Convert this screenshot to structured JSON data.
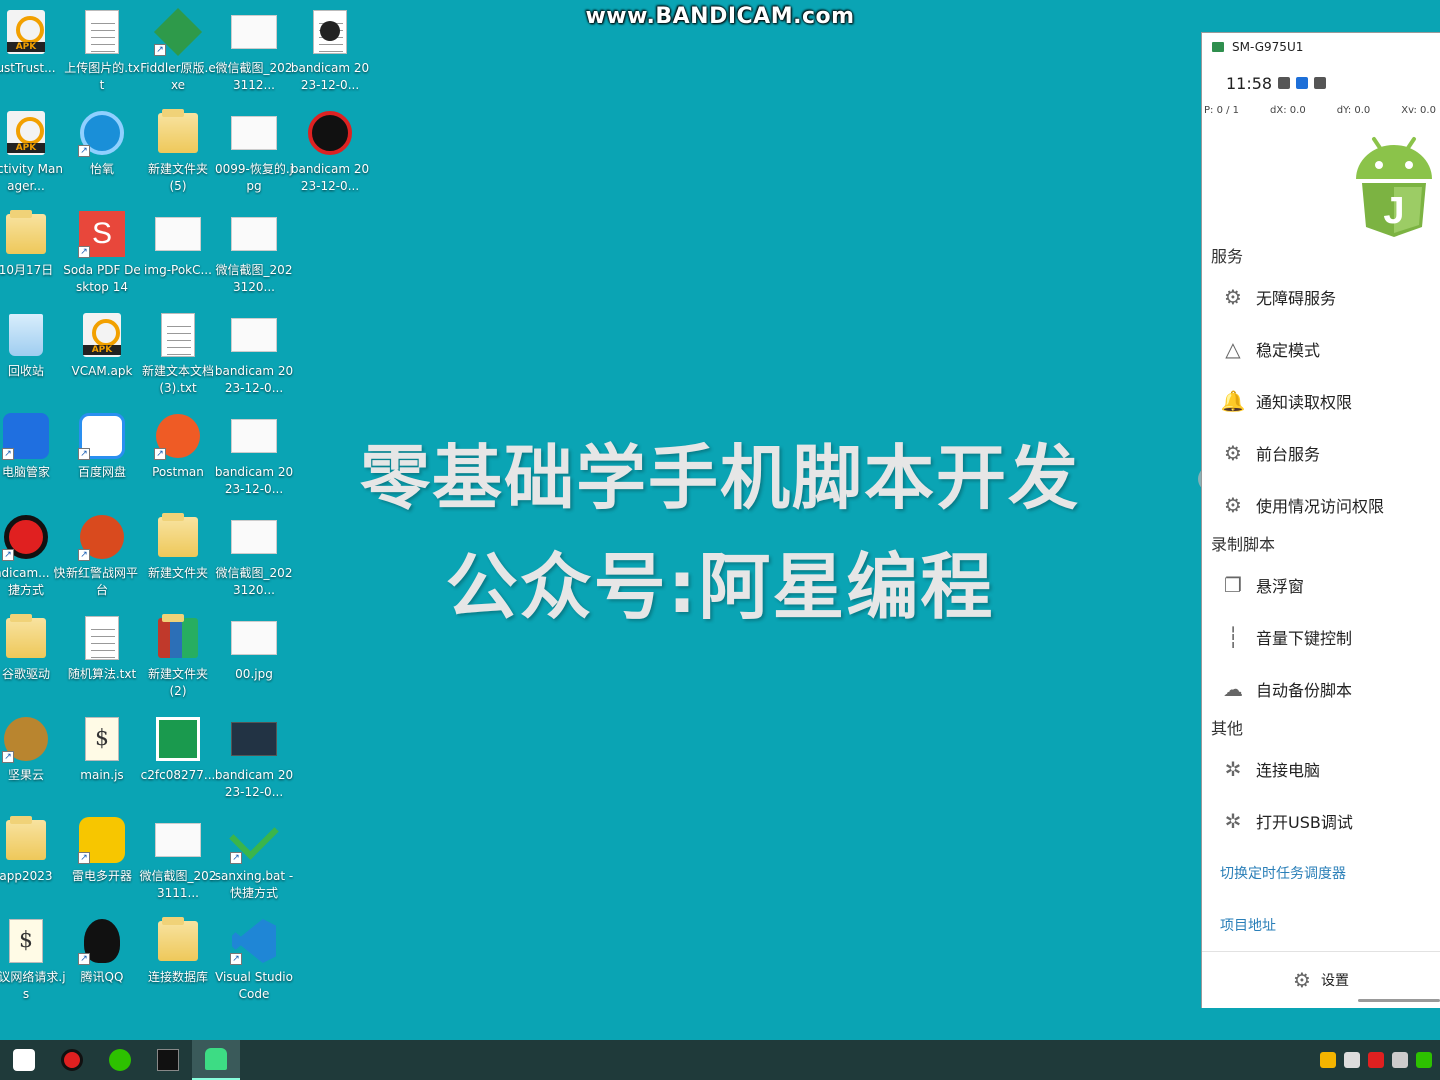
{
  "watermark": "www.BANDICAM.com",
  "overlay": {
    "line1": "零基础学手机脚本开发",
    "line2": "公众号:阿星编程"
  },
  "desktop_icons": [
    {
      "label": "ustTrust...",
      "icon": "apk-icon",
      "col": 0,
      "row": 0
    },
    {
      "label": "上传图片的.txt",
      "icon": "text-file-icon",
      "col": 1,
      "row": 0
    },
    {
      "label": "Fiddler原版.exe",
      "icon": "fiddler-icon",
      "col": 2,
      "row": 0
    },
    {
      "label": "微信截图_2023112...",
      "icon": "image-thumb-icon",
      "col": 3,
      "row": 0
    },
    {
      "label": "bandicam 2023-12-0...",
      "icon": "video-icon",
      "col": 4,
      "row": 0
    },
    {
      "label": "Activity Manager...",
      "icon": "apk-icon",
      "col": 0,
      "row": 1
    },
    {
      "label": "怡氧",
      "icon": "app-shortcut-icon",
      "col": 1,
      "row": 1
    },
    {
      "label": "新建文件夹 (5)",
      "icon": "folder-icon",
      "col": 2,
      "row": 1
    },
    {
      "label": "0099-恢复的.jpg",
      "icon": "image-thumb-icon",
      "col": 3,
      "row": 1
    },
    {
      "label": "bandicam 2023-12-0...",
      "icon": "bandicam-tool-icon",
      "col": 4,
      "row": 1
    },
    {
      "label": "10月17日",
      "icon": "folder-icon",
      "col": 0,
      "row": 2
    },
    {
      "label": "Soda PDF Desktop 14",
      "icon": "soda-pdf-icon",
      "col": 1,
      "row": 2
    },
    {
      "label": "img-PokC...",
      "icon": "image-thumb-icon",
      "col": 2,
      "row": 2
    },
    {
      "label": "微信截图_2023120...",
      "icon": "image-thumb-icon",
      "col": 3,
      "row": 2
    },
    {
      "label": "回收站",
      "icon": "recycle-bin-icon",
      "col": 0,
      "row": 3
    },
    {
      "label": "VCAM.apk",
      "icon": "apk-icon",
      "col": 1,
      "row": 3
    },
    {
      "label": "新建文本文档 (3).txt",
      "icon": "text-file-icon",
      "col": 2,
      "row": 3
    },
    {
      "label": "bandicam 2023-12-0...",
      "icon": "image-thumb-icon",
      "col": 3,
      "row": 3
    },
    {
      "label": "电脑管家",
      "icon": "pc-manager-icon",
      "col": 0,
      "row": 4
    },
    {
      "label": "百度网盘",
      "icon": "baidu-netdisk-icon",
      "col": 1,
      "row": 4
    },
    {
      "label": "Postman",
      "icon": "postman-icon",
      "col": 2,
      "row": 4
    },
    {
      "label": "bandicam 2023-12-0...",
      "icon": "image-thumb-icon",
      "col": 3,
      "row": 4
    },
    {
      "label": "andicam... 快捷方式",
      "icon": "bandicam-record-icon",
      "col": 0,
      "row": 5
    },
    {
      "label": "新红警战网平台",
      "icon": "red-alert-icon",
      "col": 1,
      "row": 5
    },
    {
      "label": "新建文件夹",
      "icon": "folder-icon",
      "col": 2,
      "row": 5
    },
    {
      "label": "微信截图_2023120...",
      "icon": "image-thumb-icon",
      "col": 3,
      "row": 5
    },
    {
      "label": "谷歌驱动",
      "icon": "folder-icon",
      "col": 0,
      "row": 6
    },
    {
      "label": "随机算法.txt",
      "icon": "text-file-icon",
      "col": 1,
      "row": 6
    },
    {
      "label": "新建文件夹 (2)",
      "icon": "archive-icon",
      "col": 2,
      "row": 6
    },
    {
      "label": "00.jpg",
      "icon": "image-thumb-icon",
      "col": 3,
      "row": 6
    },
    {
      "label": "坚果云",
      "icon": "nutstore-icon",
      "col": 0,
      "row": 7
    },
    {
      "label": "main.js",
      "icon": "js-file-icon",
      "col": 1,
      "row": 7
    },
    {
      "label": "c2fc08277...",
      "icon": "green-app-icon",
      "col": 2,
      "row": 7
    },
    {
      "label": "bandicam 2023-12-0...",
      "icon": "video-thumb-icon",
      "col": 3,
      "row": 7
    },
    {
      "label": "app2023",
      "icon": "folder-icon",
      "col": 0,
      "row": 8
    },
    {
      "label": "雷电多开器",
      "icon": "ldplayer-icon",
      "col": 1,
      "row": 8
    },
    {
      "label": "微信截图_2023111...",
      "icon": "image-thumb-icon",
      "col": 2,
      "row": 8
    },
    {
      "label": "sanxing.bat - 快捷方式",
      "icon": "checkmark-icon",
      "col": 3,
      "row": 8
    },
    {
      "label": "协议网络请求.js",
      "icon": "js-file-icon",
      "col": 0,
      "row": 9
    },
    {
      "label": "腾讯QQ",
      "icon": "qq-icon",
      "col": 1,
      "row": 9
    },
    {
      "label": "连接数据库",
      "icon": "folder-icon",
      "col": 2,
      "row": 9
    },
    {
      "label": "Visual Studio Code",
      "icon": "vscode-icon",
      "col": 3,
      "row": 9
    }
  ],
  "phone": {
    "window_title": "SM-G975U1",
    "time": "11:58",
    "pointer": {
      "p": "P: 0 / 1",
      "dx": "dX: 0.0",
      "dy": "dY: 0.0",
      "xv": "Xv: 0.0"
    },
    "sections": [
      {
        "title": "服务",
        "items": [
          {
            "label": "无障碍服务",
            "icon": "gear-icon"
          },
          {
            "label": "稳定模式",
            "icon": "triangle-icon"
          },
          {
            "label": "通知读取权限",
            "icon": "bell-icon"
          },
          {
            "label": "前台服务",
            "icon": "gear-icon"
          },
          {
            "label": "使用情况访问权限",
            "icon": "gear-icon"
          }
        ]
      },
      {
        "title": "录制脚本",
        "items": [
          {
            "label": "悬浮窗",
            "icon": "floating-window-icon"
          },
          {
            "label": "音量下键控制",
            "icon": "sound-wave-icon"
          },
          {
            "label": "自动备份脚本",
            "icon": "cloud-upload-icon"
          }
        ]
      },
      {
        "title": "其他",
        "items": [
          {
            "label": "连接电脑",
            "icon": "bug-icon"
          },
          {
            "label": "打开USB调试",
            "icon": "bug-icon"
          }
        ]
      }
    ],
    "links": [
      "切换定时任务调度器",
      "项目地址"
    ],
    "settings_label": "设置"
  },
  "taskbar": {
    "apps": [
      "capcut-icon",
      "bandicam-icon",
      "wechat-icon",
      "terminal-icon",
      "android-emulator-icon"
    ],
    "tray": [
      "chrome-icon",
      "network-icon",
      "record-icon",
      "shield-icon",
      "wechat-tray-icon"
    ]
  },
  "colors": {
    "desktop_bg": "#0aa4b4",
    "link": "#2a7fb8",
    "android_green": "#8bc34a"
  }
}
